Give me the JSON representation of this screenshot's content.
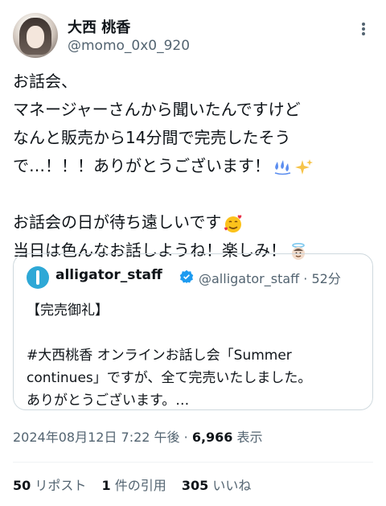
{
  "author": {
    "display_name": "大西 桃香",
    "handle": "@momo_0x0_920"
  },
  "tweet": {
    "lines": [
      "お話会、",
      "マネージャーさんから聞いたんですけど",
      "なんと販売から14分間で完売したそう",
      "で…！！！ありがとうございます！",
      "",
      "お話会の日が待ち遠しいです",
      "当日は色んなお話しようね！楽しみ！"
    ],
    "emojis": [
      "sweat-droplets-icon",
      "sparkles-icon",
      "smiling-face-with-hearts-icon",
      "smiling-face-with-halo-icon"
    ]
  },
  "quoted": {
    "name": "alligator_staff",
    "handle": "@alligator_staff",
    "time": "· 52分",
    "lines": [
      "【完売御礼】",
      "",
      "#大西桃香 オンラインお話し会「Summer",
      "continues」ですが、全て完売いたしました。",
      "ありがとうございます。…"
    ]
  },
  "meta": {
    "datetime": "2024年08月12日 7:22 午後",
    "separator": "·",
    "views": "6,966",
    "views_label": "表示"
  },
  "stats": {
    "reposts": "50",
    "reposts_label": "リポスト",
    "quotes": "1",
    "quotes_label": "件の引用",
    "likes": "305",
    "likes_label": "いいね"
  },
  "colors": {
    "text": "#0f1419",
    "secondary": "#536471",
    "border": "#cfd9de",
    "verified": "#1d9bf0"
  }
}
